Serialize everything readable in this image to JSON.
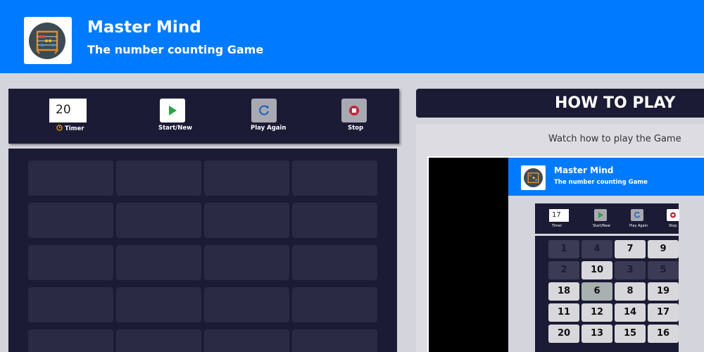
{
  "header": {
    "title": "Master Mind",
    "subtitle": "The number counting Game"
  },
  "controls": {
    "timer_value": "20",
    "timer_label": "Timer",
    "start_label": "Start/New",
    "play_again_label": "Play Again",
    "stop_label": "Stop"
  },
  "howto": {
    "title": "HOW TO PLAY",
    "watch_text": "Watch how to play the Game"
  },
  "video": {
    "title": "Master Mind",
    "subtitle": "The number counting Game",
    "timer_value": "17",
    "timer_label": "Timer",
    "start_label": "Start/New",
    "play_again_label": "Play Again",
    "stop_label": "Stop",
    "tiles": [
      "1",
      "4",
      "7",
      "9",
      "2",
      "10",
      "3",
      "5",
      "18",
      "6",
      "8",
      "19",
      "11",
      "12",
      "14",
      "17",
      "20",
      "13",
      "15",
      "16"
    ]
  },
  "colors": {
    "brand_blue": "#007bff",
    "panel_navy": "#1c1b35",
    "start_green": "#28a745",
    "play_again_blue": "#1d5fb8",
    "stop_red": "#c0283c"
  }
}
